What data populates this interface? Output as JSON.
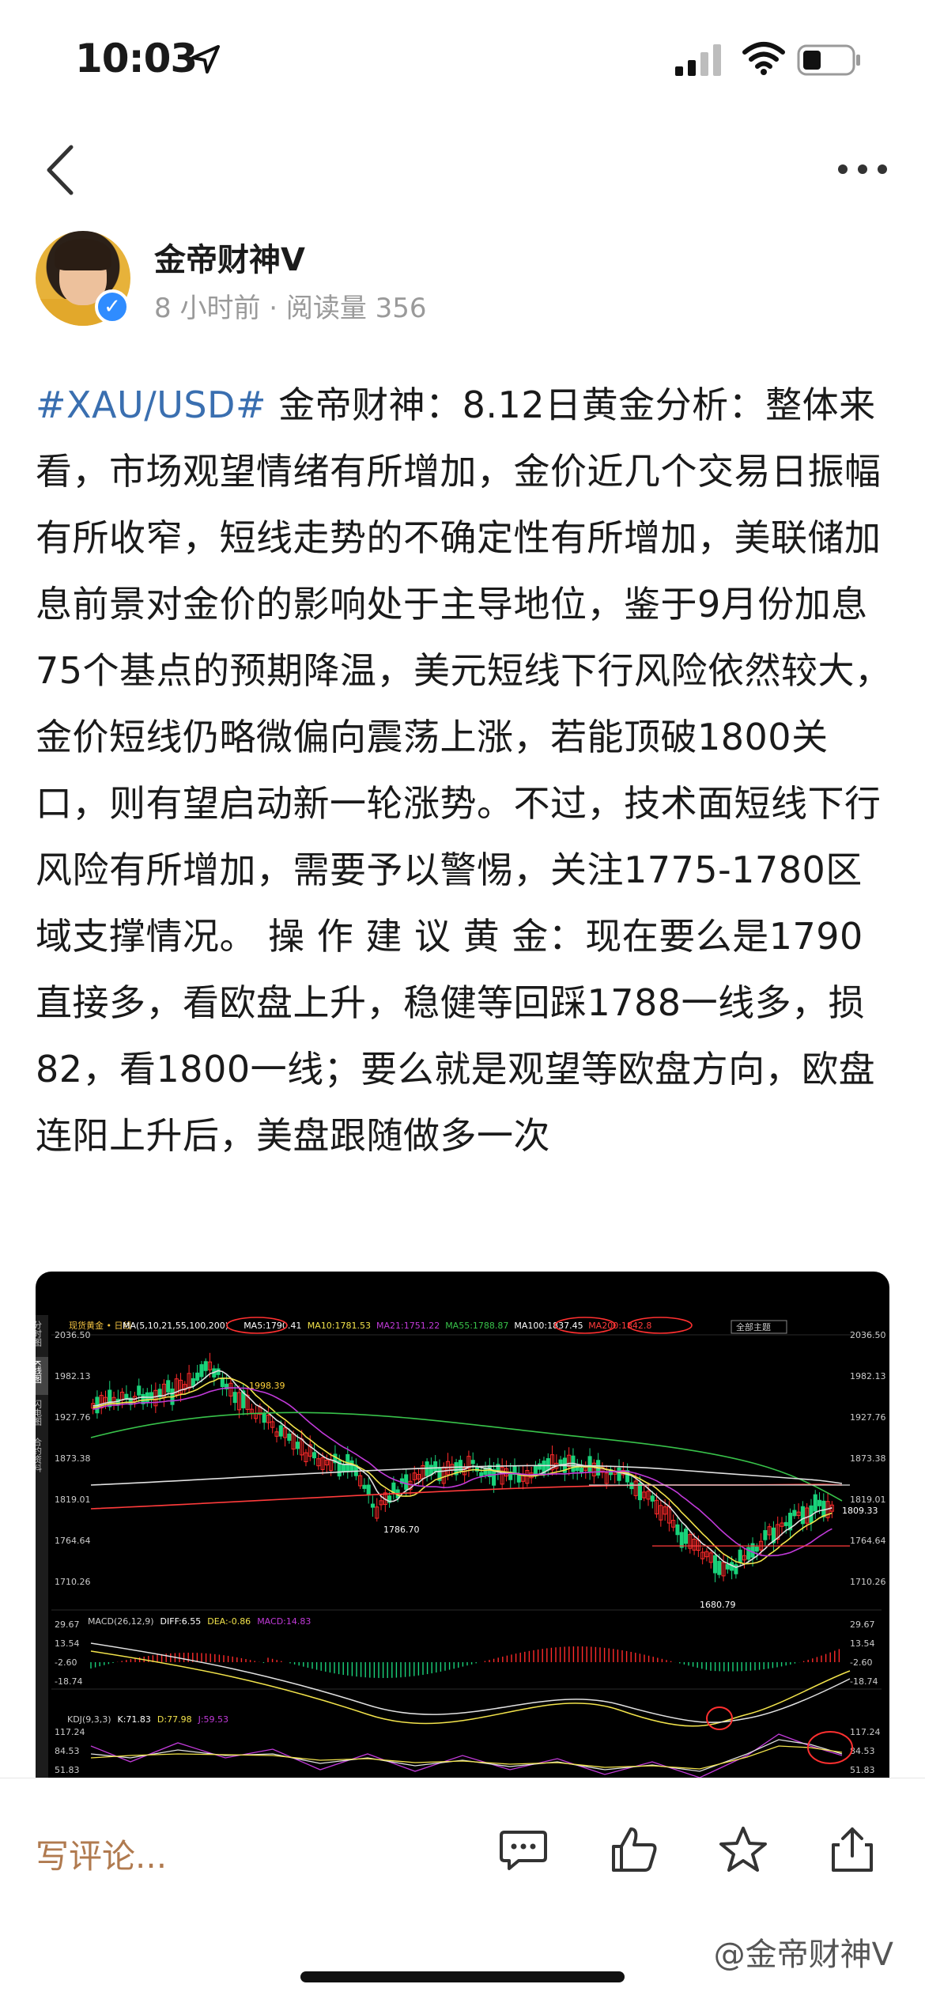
{
  "status": {
    "time": "10:03"
  },
  "author": {
    "name": "金帝财神V",
    "meta": "8 小时前 · 阅读量 356"
  },
  "post": {
    "topic": "#XAU/USD#",
    "text": " 金帝财神：8.12日黄金分析：整体来看，市场观望情绪有所增加，金价近几个交易日振幅有所收窄，短线走势的不确定性有所增加，美联储加息前景对金价的影响处于主导地位，鉴于9月份加息75个基点的预期降温，美元短线下行风险依然较大，金价短线仍略微偏向震荡上涨，若能顶破1800关口，则有望启动新一轮涨势。不过，技术面短线下行风险有所增加，需要予以警惕，关注1775-1780区域支撑情况。 操 作 建 议 黄 金：现在要么是1790直接多，看欧盘上升，稳健等回踩1788一线多，损82，看1800一线；要么就是观望等欧盘方向，欧盘连阳上升后，美盘跟随做多一次"
  },
  "chart_image": {
    "header": "现货黄金 • 日线",
    "ma_legend": [
      "MA(5,10,21,55,100,200)",
      "MA5:1790.41",
      "MA10:1781.53",
      "MA21:1751.22",
      "MA55:1788.87",
      "MA100:1837.45",
      "MA200:1842.8"
    ],
    "top_right_label": "全部主题",
    "left_tabs": [
      "分时图",
      "K线图",
      "闪电图",
      "合约资料"
    ],
    "price_axis": [
      "2036.50",
      "1982.13",
      "1927.76",
      "1873.38",
      "1819.01",
      "1764.64",
      "1710.26"
    ],
    "right_extra": "1809.33",
    "price_annotations": [
      "1998.39",
      "1786.70",
      "1680.79"
    ],
    "macd_legend": [
      "MACD(26,12,9)",
      "DIFF:6.55",
      "DEA:-0.86",
      "MACD:14.83"
    ],
    "macd_axis": [
      "29.67",
      "13.54",
      "-2.60",
      "-18.74"
    ],
    "kdj_legend": [
      "KDJ(9,3,3)",
      "K:71.83",
      "D:77.98",
      "J:59.53"
    ],
    "kdj_axis": [
      "117.24",
      "84.53",
      "51.83"
    ],
    "colors": {
      "up": "#ff2a2a",
      "down": "#19d27a",
      "ma_white": "#e0e0e0",
      "ma_yellow": "#f2e34b",
      "ma_purple": "#c13ad9",
      "ma_green": "#38c24a",
      "ma_red": "#ff3b3b"
    }
  },
  "bottom_bar": {
    "comment_placeholder": "写评论...",
    "watermark": "@金帝财神V"
  },
  "icons": {
    "back": "chevron-left-icon",
    "more": "more-dots-icon",
    "comment": "comment-icon",
    "like": "thumbs-up-icon",
    "favorite": "star-icon",
    "share": "share-icon"
  }
}
